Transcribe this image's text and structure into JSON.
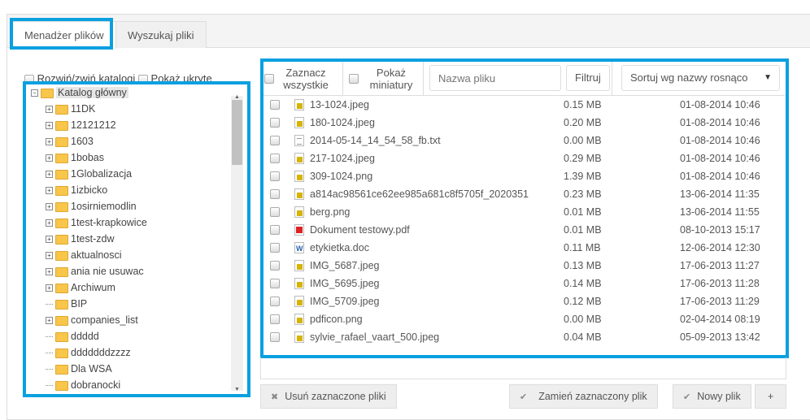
{
  "tabs": [
    {
      "label": "Menadżer plików",
      "active": true
    },
    {
      "label": "Wyszukaj pliki",
      "active": false
    }
  ],
  "tree_options": {
    "expand_label": "Rozwiń/zwiń katalogi",
    "hidden_label": "Pokaż ukryte"
  },
  "tree": {
    "root": "Katalog główny",
    "items": [
      {
        "label": "11DK",
        "expandable": true
      },
      {
        "label": "12121212",
        "expandable": true
      },
      {
        "label": "1603",
        "expandable": true
      },
      {
        "label": "1bobas",
        "expandable": true
      },
      {
        "label": "1Globalizacja",
        "expandable": true
      },
      {
        "label": "1izbicko",
        "expandable": true
      },
      {
        "label": "1osirniemodlin",
        "expandable": true
      },
      {
        "label": "1test-krapkowice",
        "expandable": true
      },
      {
        "label": "1test-zdw",
        "expandable": true
      },
      {
        "label": "aktualnosci",
        "expandable": true
      },
      {
        "label": "ania nie usuwac",
        "expandable": true
      },
      {
        "label": "Archiwum",
        "expandable": true
      },
      {
        "label": "BIP",
        "expandable": false
      },
      {
        "label": "companies_list",
        "expandable": true
      },
      {
        "label": "ddddd",
        "expandable": false
      },
      {
        "label": "dddddddzzzz",
        "expandable": false
      },
      {
        "label": "Dla WSA",
        "expandable": false
      },
      {
        "label": "dobranocki",
        "expandable": false
      }
    ]
  },
  "toolbar": {
    "select_all": "Zaznacz wszystkie",
    "show_thumbs": "Pokaż miniatury",
    "filename_placeholder": "Nazwa pliku",
    "filter": "Filtruj",
    "sort": "Sortuj wg nazwy rosnąco"
  },
  "files": [
    {
      "name": "13-1024.jpeg",
      "type": "img",
      "size": "0.15 MB",
      "date": "01-08-2014 10:46"
    },
    {
      "name": "180-1024.jpeg",
      "type": "img",
      "size": "0.20 MB",
      "date": "01-08-2014 10:46"
    },
    {
      "name": "2014-05-14_14_54_58_fb.txt",
      "type": "txt",
      "size": "0.00 MB",
      "date": "01-08-2014 10:46"
    },
    {
      "name": "217-1024.jpeg",
      "type": "img",
      "size": "0.29 MB",
      "date": "01-08-2014 10:46"
    },
    {
      "name": "309-1024.png",
      "type": "img",
      "size": "1.39 MB",
      "date": "01-08-2014 10:46"
    },
    {
      "name": "a814ac98561ce62ee985a681c8f5705f_2020351",
      "type": "img",
      "size": "0.23 MB",
      "date": "13-06-2014 11:35"
    },
    {
      "name": "berg.png",
      "type": "img",
      "size": "0.01 MB",
      "date": "13-06-2014 11:55"
    },
    {
      "name": "Dokument testowy.pdf",
      "type": "pdf",
      "size": "0.01 MB",
      "date": "08-10-2013 15:17"
    },
    {
      "name": "etykietka.doc",
      "type": "doc",
      "size": "0.11 MB",
      "date": "12-06-2014 12:30"
    },
    {
      "name": "IMG_5687.jpeg",
      "type": "img",
      "size": "0.13 MB",
      "date": "17-06-2013 11:27"
    },
    {
      "name": "IMG_5695.jpeg",
      "type": "img",
      "size": "0.14 MB",
      "date": "17-06-2013 11:28"
    },
    {
      "name": "IMG_5709.jpeg",
      "type": "img",
      "size": "0.12 MB",
      "date": "17-06-2013 11:29"
    },
    {
      "name": "pdficon.png",
      "type": "img",
      "size": "0.00 MB",
      "date": "02-04-2014 08:19"
    },
    {
      "name": "sylvie_rafael_vaart_500.jpeg",
      "type": "img",
      "size": "0.04 MB",
      "date": "05-09-2013 13:42"
    }
  ],
  "actions": {
    "delete": "Usuń zaznaczone pliki",
    "replace": "Zamień zaznaczony plik",
    "new": "Nowy plik",
    "add": "+"
  },
  "colors": {
    "highlight": "#0aa0e0",
    "folder": "#f8c64a"
  }
}
